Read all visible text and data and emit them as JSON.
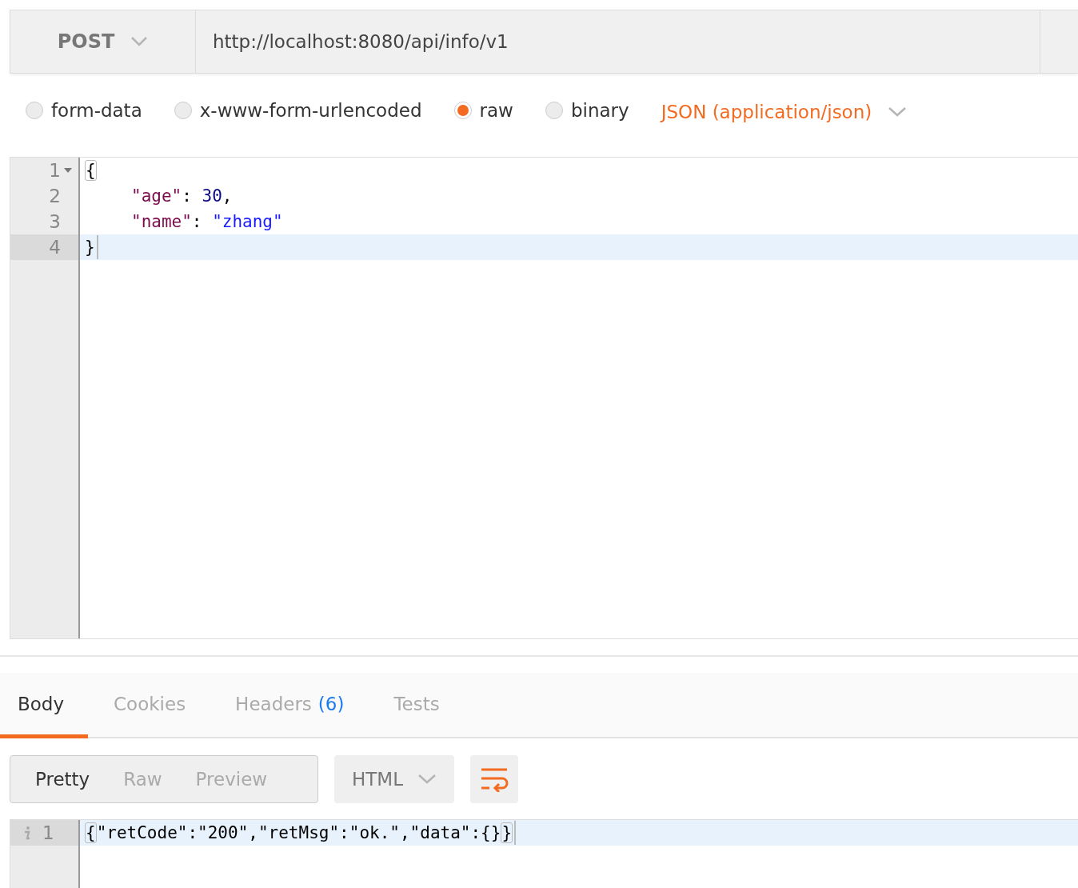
{
  "request": {
    "method": "POST",
    "url": "http://localhost:8080/api/info/v1"
  },
  "body_types": [
    {
      "label": "form-data",
      "selected": false
    },
    {
      "label": "x-www-form-urlencoded",
      "selected": false
    },
    {
      "label": "raw",
      "selected": true
    },
    {
      "label": "binary",
      "selected": false
    }
  ],
  "content_type": "JSON (application/json)",
  "editor": {
    "lines": [
      {
        "number": "1",
        "foldable": true,
        "active": false,
        "indented": false,
        "tokens": [
          {
            "kind": "brace",
            "text": "{"
          }
        ]
      },
      {
        "number": "2",
        "foldable": false,
        "active": false,
        "indented": true,
        "tokens": [
          {
            "kind": "key",
            "text": "\"age\""
          },
          {
            "kind": "punct",
            "text": ": "
          },
          {
            "kind": "number",
            "text": "30"
          },
          {
            "kind": "punct",
            "text": ","
          }
        ]
      },
      {
        "number": "3",
        "foldable": false,
        "active": false,
        "indented": true,
        "tokens": [
          {
            "kind": "key",
            "text": "\"name\""
          },
          {
            "kind": "punct",
            "text": ": "
          },
          {
            "kind": "string",
            "text": "\"zhang\""
          }
        ]
      },
      {
        "number": "4",
        "foldable": false,
        "active": true,
        "indented": false,
        "tokens": [
          {
            "kind": "punct",
            "text": "}"
          }
        ]
      }
    ]
  },
  "response_tabs": [
    {
      "label": "Body",
      "selected": true
    },
    {
      "label": "Cookies",
      "selected": false
    },
    {
      "label": "Headers",
      "count": "(6)",
      "selected": false
    },
    {
      "label": "Tests",
      "selected": false
    }
  ],
  "view_modes": [
    {
      "label": "Pretty",
      "selected": true
    },
    {
      "label": "Raw",
      "selected": false
    },
    {
      "label": "Preview",
      "selected": false
    }
  ],
  "format": "HTML",
  "response": {
    "lines": [
      {
        "number": "1",
        "active": true,
        "tokens": [
          {
            "kind": "brace",
            "text": "{"
          },
          {
            "kind": "punct",
            "text": "\"retCode\":\"200\",\"retMsg\":\"ok.\",\"data\":{}"
          },
          {
            "kind": "brace",
            "text": "}"
          }
        ]
      }
    ]
  }
}
